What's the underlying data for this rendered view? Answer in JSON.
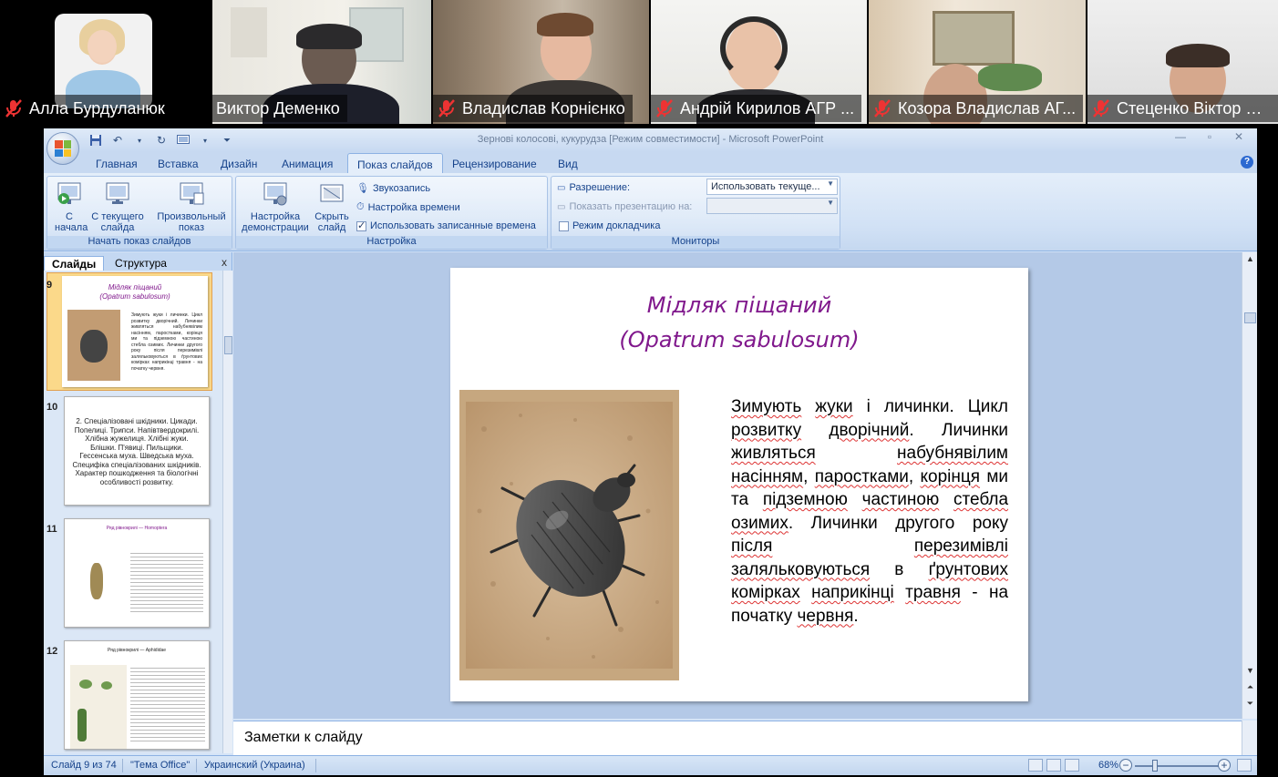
{
  "participants": [
    {
      "name": "Алла Бурдуланюк",
      "muted": true,
      "active": false
    },
    {
      "name": "Виктор Деменко",
      "muted": false,
      "active": true
    },
    {
      "name": "Владислав Корнієнко",
      "muted": true,
      "active": false
    },
    {
      "name": "Андрій Кирилов АГР ...",
      "muted": true,
      "active": false
    },
    {
      "name": "Козора Владислав АГ...",
      "muted": true,
      "active": false
    },
    {
      "name": "Стеценко Віктор АГР",
      "muted": true,
      "active": false
    }
  ],
  "window": {
    "title": "Зернові колосові, кукурудза [Режим совместимости] - Microsoft PowerPoint"
  },
  "tabs": [
    "Главная",
    "Вставка",
    "Дизайн",
    "Анимация",
    "Показ слайдов",
    "Рецензирование",
    "Вид"
  ],
  "active_tab": "Показ слайдов",
  "ribbon": {
    "start_group": {
      "label": "Начать показ слайдов",
      "from_start": "С начала",
      "from_current": "С текущего слайда",
      "custom": "Произвольный показ"
    },
    "setup_group": {
      "label": "Настройка",
      "setup_show": "Настройка демонстрации",
      "hide_slide": "Скрыть слайд",
      "record_narration": "Звукозапись",
      "rehearse_timings": "Настройка времени",
      "use_timings": "Использовать записанные времена",
      "use_timings_checked": true
    },
    "monitors_group": {
      "label": "Мониторы",
      "resolution_label": "Разрешение:",
      "resolution_value": "Использовать текуще...",
      "show_on_label": "Показать презентацию на:",
      "show_on_value": "",
      "presenter_view": "Режим докладчика",
      "presenter_view_checked": false
    }
  },
  "slides_pane": {
    "tab_slides": "Слайды",
    "tab_outline": "Структура",
    "close": "x",
    "thumbnails": [
      {
        "number": "9",
        "selected": true,
        "title": "Мідляк піщаний",
        "subtitle": "(Opatrum sabulosum)",
        "text": "Зимують жуки і личинки. Цикл розвитку дворічний. Личинки живляться набубнявілим насінням, паростками, корінця ми та підземною частиною стебла озимих. Личинки другого року після перезимівлі заляльковуються в ґрунтових комірках наприкінці травня - на початку червня."
      },
      {
        "number": "10",
        "selected": false,
        "text": "2. Спеціалізовані шкідники. Цикади. Попелиці. Трипси. Напівтвердокрилі. Хлібна жужелиця. Хлібні жуки. Блішки. П'явиці. Пильщики. Гессенська муха. Шведська муха. Специфіка спеціалізованих шкідників. Характер пошкодження та біологічні особливості розвитку."
      },
      {
        "number": "11",
        "selected": false,
        "text": "Ряд рівнокрилі — Homoptera"
      },
      {
        "number": "12",
        "selected": false,
        "text": "Ряд рівнокрилі — Aphididae"
      }
    ]
  },
  "slide": {
    "title_line1": "Мідляк піщаний",
    "title_line2": "(Opatrum sabulosum)",
    "body": [
      {
        "text": "Зимують",
        "u": true
      },
      {
        "text": " "
      },
      {
        "text": "жуки",
        "u": true
      },
      {
        "text": " і личинки. Цикл "
      },
      {
        "text": "розвитку",
        "u": true
      },
      {
        "text": " "
      },
      {
        "text": "дворічний",
        "u": true
      },
      {
        "text": ". Личинки "
      },
      {
        "text": "живляться",
        "u": true
      },
      {
        "text": " "
      },
      {
        "text": "набубнявілим",
        "u": true
      },
      {
        "text": " "
      },
      {
        "text": "насінням",
        "u": true
      },
      {
        "text": ", "
      },
      {
        "text": "паростками",
        "u": true
      },
      {
        "text": ", "
      },
      {
        "text": "корінця",
        "u": true
      },
      {
        "text": " ми та "
      },
      {
        "text": "підземною",
        "u": true
      },
      {
        "text": " "
      },
      {
        "text": "частиною",
        "u": true
      },
      {
        "text": " "
      },
      {
        "text": "стебла",
        "u": true
      },
      {
        "text": " "
      },
      {
        "text": "озимих",
        "u": true
      },
      {
        "text": ". Личинки другого року "
      },
      {
        "text": "після",
        "u": true
      },
      {
        "text": " "
      },
      {
        "text": "перезимівлі",
        "u": true
      },
      {
        "text": " "
      },
      {
        "text": "заляльковуються",
        "u": true
      },
      {
        "text": " в "
      },
      {
        "text": "ґрунтових",
        "u": true
      },
      {
        "text": " "
      },
      {
        "text": "комірках",
        "u": true
      },
      {
        "text": " "
      },
      {
        "text": "наприкінці",
        "u": true
      },
      {
        "text": " "
      },
      {
        "text": "травня",
        "u": true
      },
      {
        "text": " - на початку "
      },
      {
        "text": "червня",
        "u": true
      },
      {
        "text": "."
      }
    ]
  },
  "notes_placeholder": "Заметки к слайду",
  "status": {
    "slide_counter": "Слайд 9 из 74",
    "theme": "\"Тема Office\"",
    "language": "Украинский (Украина)",
    "zoom": "68%",
    "zoom_fraction": 0.68
  },
  "colors": {
    "accent_green": "#23d96b",
    "title_purple": "#80188c",
    "ribbon_blue": "#15428b"
  }
}
